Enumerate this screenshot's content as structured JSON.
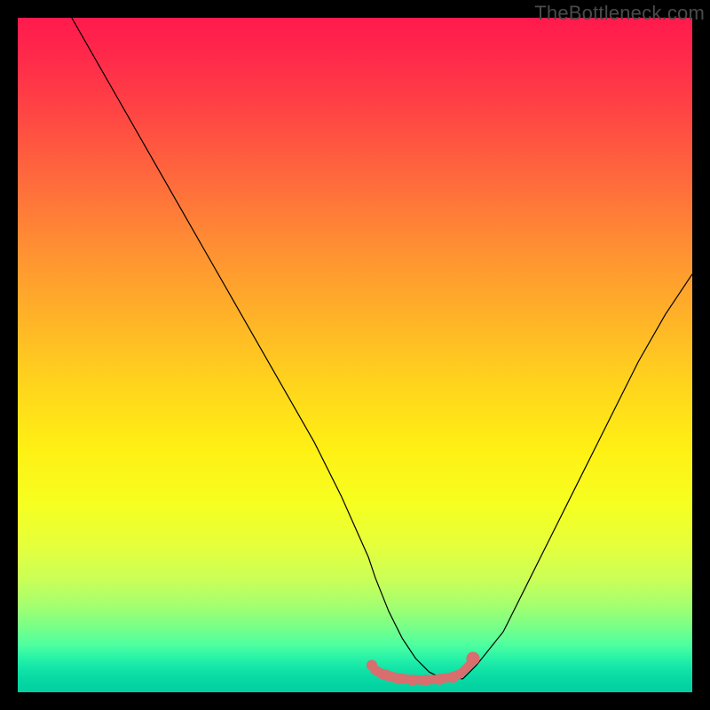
{
  "watermark": "TheBottleneck.com",
  "chart_data": {
    "type": "line",
    "title": "",
    "xlabel": "",
    "ylabel": "",
    "xlim": [
      0,
      100
    ],
    "ylim": [
      0,
      100
    ],
    "grid": false,
    "legend": false,
    "series": [
      {
        "name": "bottleneck-curve",
        "color": "#000000",
        "x": [
          8,
          12,
          16,
          20,
          24,
          28,
          32,
          36,
          40,
          44,
          48,
          52,
          53,
          55,
          57,
          59,
          61,
          63,
          65,
          66,
          68,
          72,
          76,
          80,
          84,
          88,
          92,
          96,
          100
        ],
        "y": [
          100,
          93,
          86,
          79,
          72,
          65,
          58,
          51,
          44,
          37,
          29,
          20,
          17,
          12,
          8,
          5,
          3,
          2,
          2,
          2,
          4,
          9,
          17,
          25,
          33,
          41,
          49,
          56,
          62
        ]
      }
    ],
    "markers": [
      {
        "name": "endpoint-left",
        "x": 52.5,
        "y": 4.0,
        "r": 0.8,
        "color": "#d86e6e"
      },
      {
        "name": "valley-1",
        "x": 54.5,
        "y": 2.6,
        "r": 0.8,
        "color": "#d86e6e"
      },
      {
        "name": "valley-2",
        "x": 56.5,
        "y": 2.0,
        "r": 0.8,
        "color": "#d86e6e"
      },
      {
        "name": "valley-3",
        "x": 58.5,
        "y": 1.8,
        "r": 0.8,
        "color": "#d86e6e"
      },
      {
        "name": "valley-4",
        "x": 60.5,
        "y": 1.8,
        "r": 0.8,
        "color": "#d86e6e"
      },
      {
        "name": "valley-5",
        "x": 62.5,
        "y": 1.9,
        "r": 0.8,
        "color": "#d86e6e"
      },
      {
        "name": "valley-6",
        "x": 64.5,
        "y": 2.2,
        "r": 0.8,
        "color": "#d86e6e"
      },
      {
        "name": "endpoint-right",
        "x": 67.5,
        "y": 5.0,
        "r": 1.0,
        "color": "#d86e6e"
      }
    ],
    "valley_band": {
      "color": "#d86e6e",
      "points_top": [
        [
          52.5,
          4.2
        ],
        [
          54.0,
          3.3
        ],
        [
          56.0,
          2.7
        ],
        [
          58.0,
          2.4
        ],
        [
          60.0,
          2.3
        ],
        [
          62.0,
          2.4
        ],
        [
          64.0,
          2.7
        ],
        [
          65.5,
          3.2
        ],
        [
          67.5,
          5.2
        ]
      ],
      "points_bottom": [
        [
          67.5,
          3.9
        ],
        [
          65.5,
          2.1
        ],
        [
          64.0,
          1.7
        ],
        [
          62.0,
          1.4
        ],
        [
          60.0,
          1.3
        ],
        [
          58.0,
          1.4
        ],
        [
          56.0,
          1.6
        ],
        [
          54.0,
          2.1
        ],
        [
          52.5,
          3.0
        ]
      ]
    }
  }
}
